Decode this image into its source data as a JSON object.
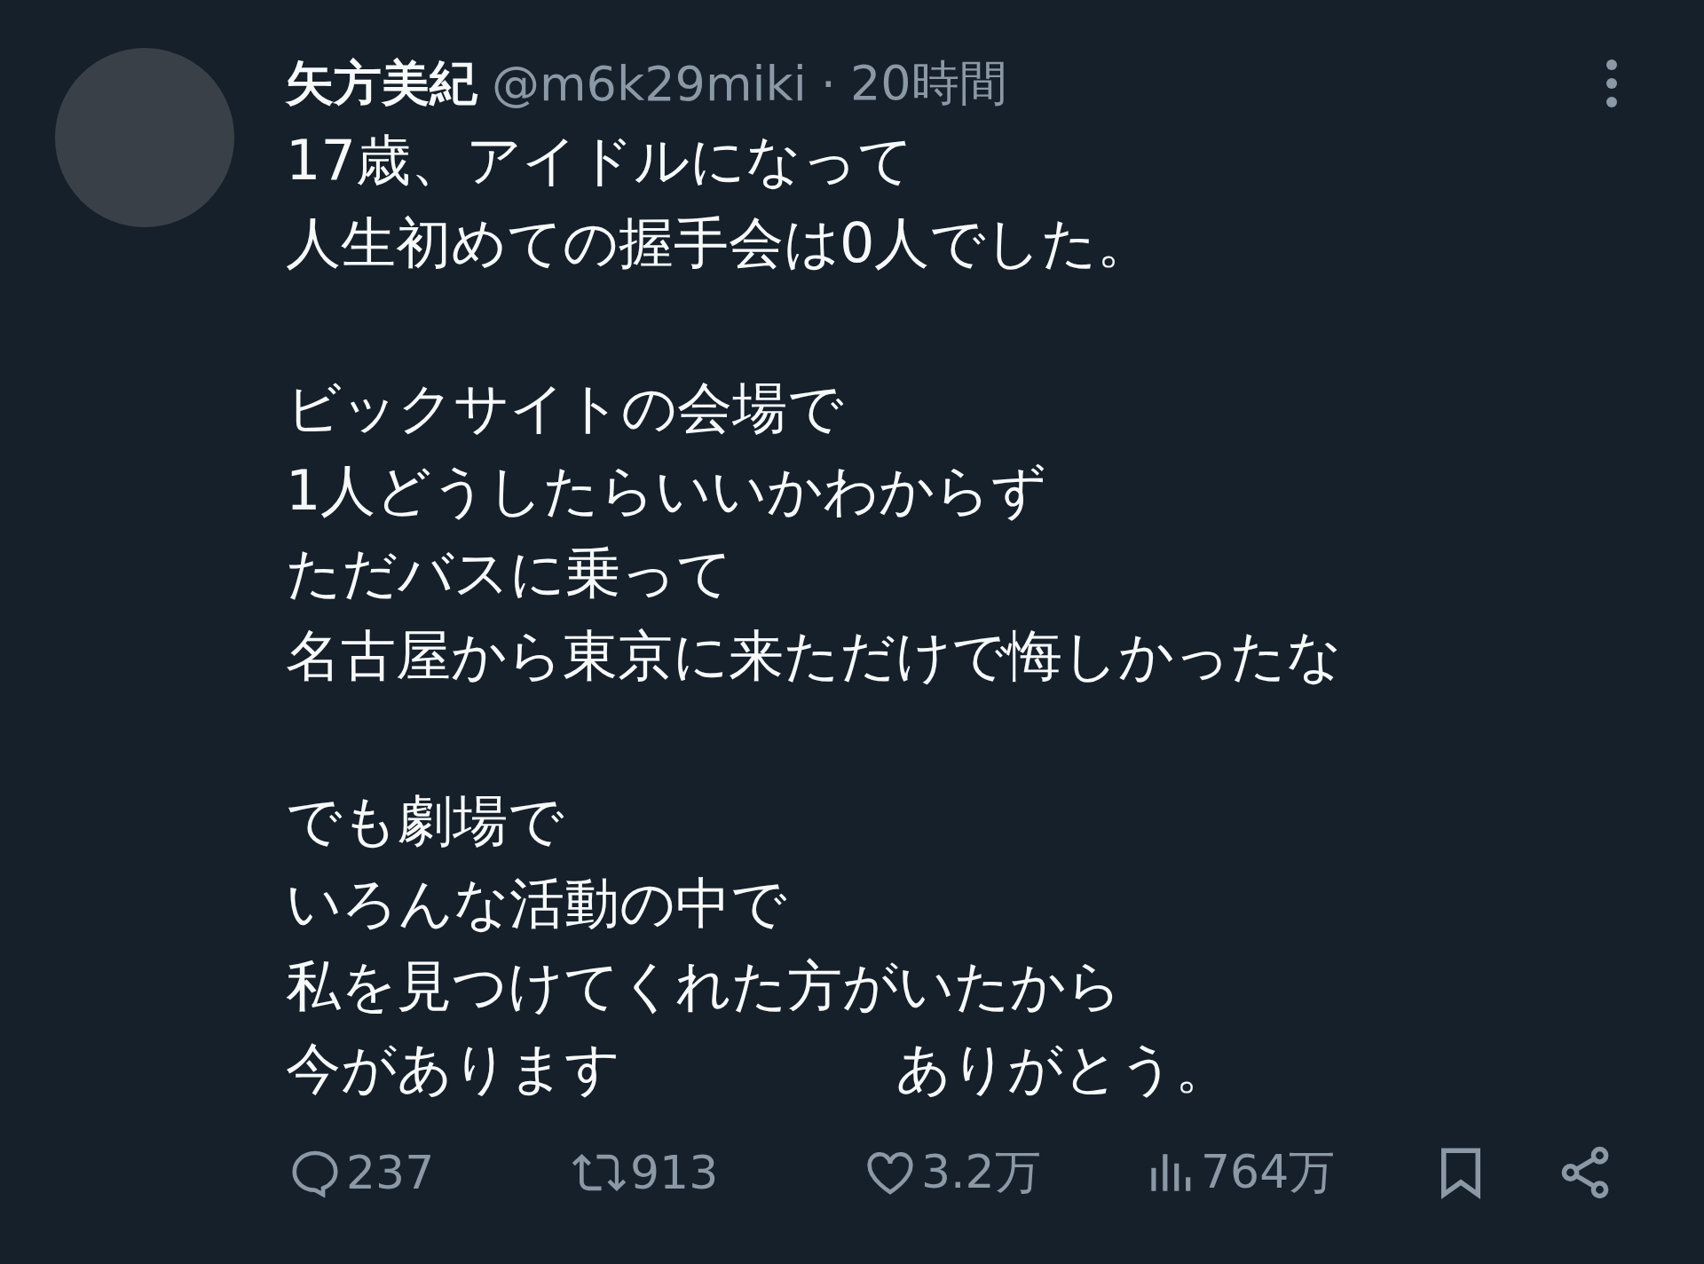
{
  "tweet": {
    "author": {
      "name": "矢方美紀",
      "handle": "@m6k29miki",
      "separator": "·",
      "time": "20時間"
    },
    "paragraphs": [
      [
        "17歳、アイドルになって",
        "人生初めての握手会は0人でした。"
      ],
      [
        "ビックサイトの会場で",
        "1人どうしたらいいかわからず",
        "ただバスに乗って",
        "名古屋から東京に来ただけで悔しかったな"
      ],
      [
        "でも劇場で",
        "いろんな活動の中で",
        "私を見つけてくれた方がいたから",
        "今があります　　　　　ありがとう。"
      ]
    ],
    "actions": [
      {
        "kind": "reply",
        "count": "237"
      },
      {
        "kind": "repost",
        "count": "913"
      },
      {
        "kind": "like",
        "count": "3.2万"
      },
      {
        "kind": "views",
        "count": "764万"
      },
      {
        "kind": "bookmark"
      },
      {
        "kind": "share"
      }
    ]
  }
}
